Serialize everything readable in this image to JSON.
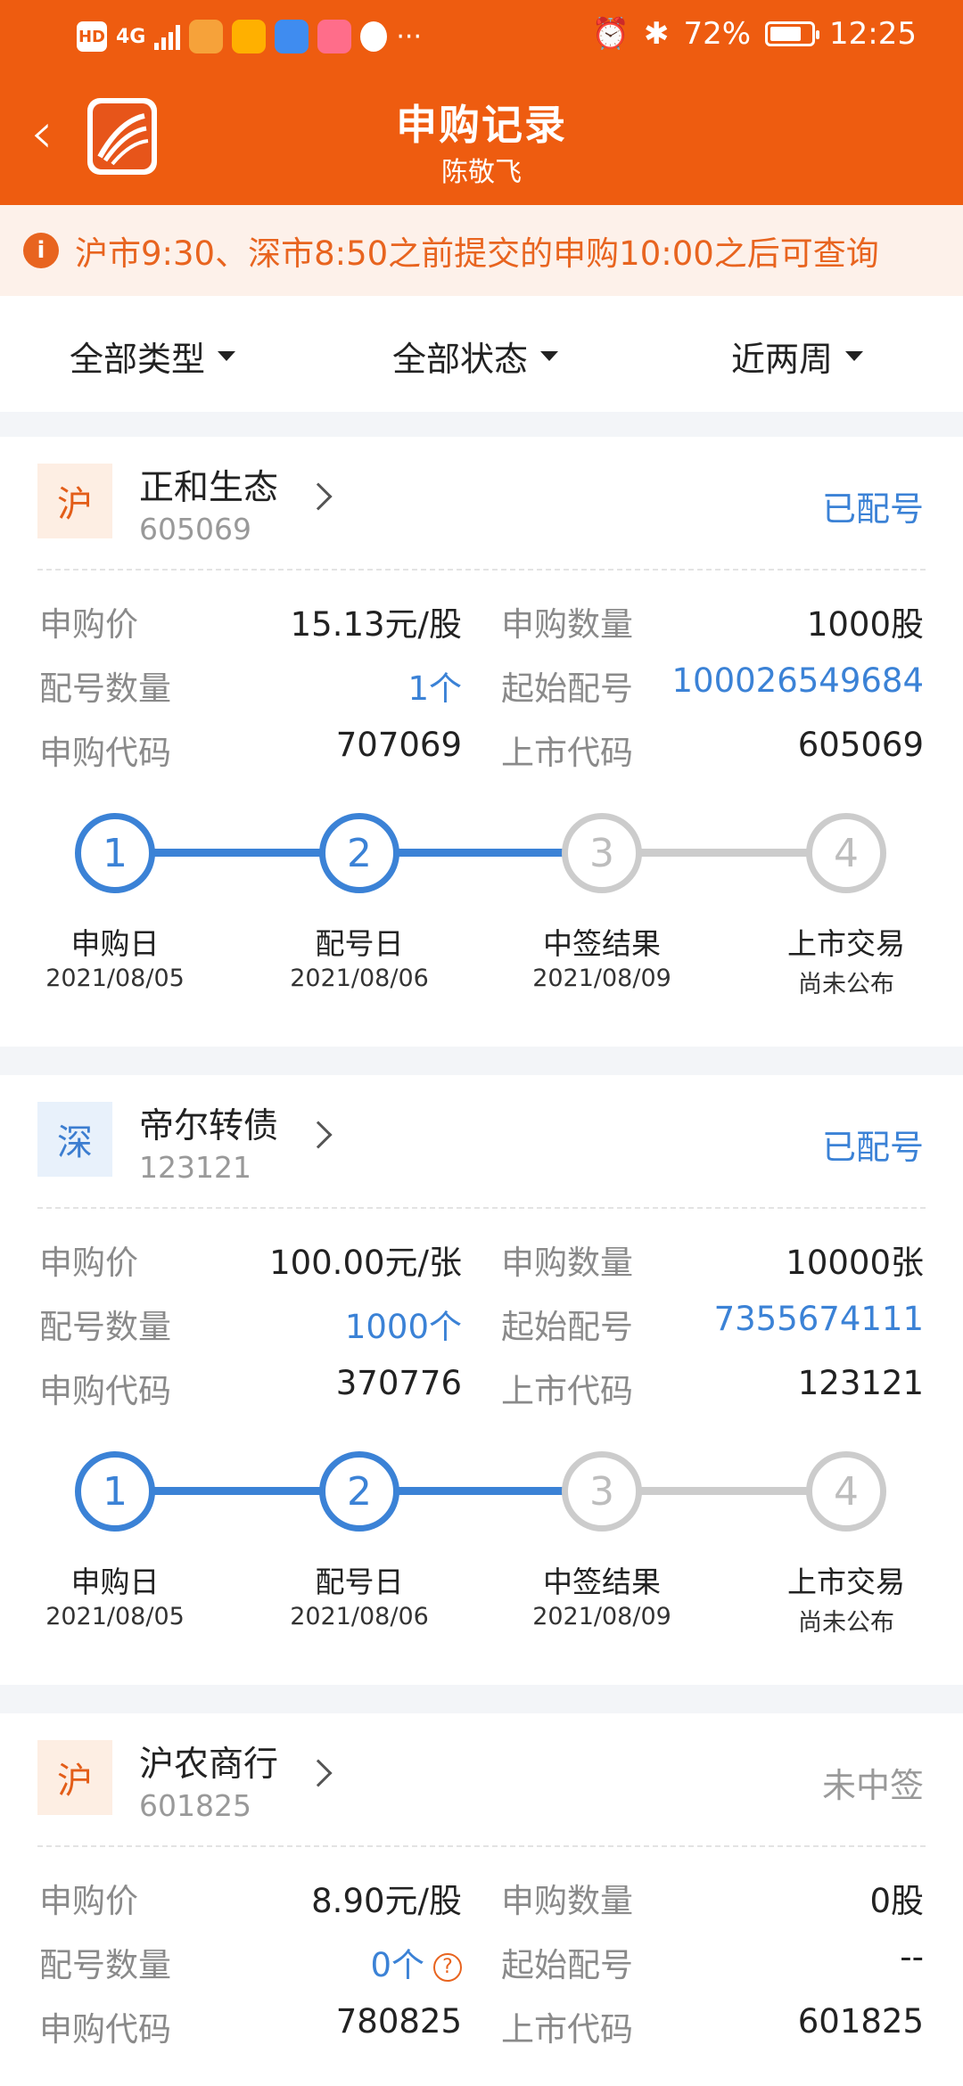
{
  "status_bar": {
    "hd": "HD",
    "signal": "4G",
    "dots": "···",
    "battery": "72%",
    "time": "12:25",
    "icons": [
      "alarm-icon",
      "bluetooth-icon",
      "battery-icon"
    ]
  },
  "header": {
    "title": "申购记录",
    "subtitle": "陈敬飞",
    "back": "‹"
  },
  "notice": {
    "icon": "i",
    "text": "沪市9:30、深市8:50之前提交的申购10:00之后可查询"
  },
  "filters": [
    "全部类型",
    "全部状态",
    "近两周"
  ],
  "labels": {
    "price": "申购价",
    "qty": "申购数量",
    "match_count": "配号数量",
    "start_no": "起始配号",
    "sub_code": "申购代码",
    "list_code": "上市代码"
  },
  "steps": [
    "申购日",
    "配号日",
    "中签结果",
    "上市交易"
  ],
  "cards": [
    {
      "market": "沪",
      "name": "正和生态",
      "code": "605069",
      "status": "已配号",
      "price": "15.13元/股",
      "qty": "1000股",
      "match_count": "1个",
      "start_no": "100026549684",
      "sub_code": "707069",
      "list_code": "605069",
      "dates": [
        "2021/08/05",
        "2021/08/06",
        "2021/08/09",
        "尚未公布"
      ],
      "progress": 2
    },
    {
      "market": "深",
      "name": "帝尔转债",
      "code": "123121",
      "status": "已配号",
      "price": "100.00元/张",
      "qty": "10000张",
      "match_count": "1000个",
      "start_no": "7355674111",
      "sub_code": "370776",
      "list_code": "123121",
      "dates": [
        "2021/08/05",
        "2021/08/06",
        "2021/08/09",
        "尚未公布"
      ],
      "progress": 2
    },
    {
      "market": "沪",
      "name": "沪农商行",
      "code": "601825",
      "status": "未中签",
      "price": "8.90元/股",
      "qty": "0股",
      "match_count": "0个",
      "start_no": "--",
      "sub_code": "780825",
      "list_code": "601825",
      "help": "?"
    }
  ],
  "colors": {
    "brand": "#ee5c10",
    "accent_blue": "#3b82d6",
    "muted": "#8a8a8a"
  }
}
